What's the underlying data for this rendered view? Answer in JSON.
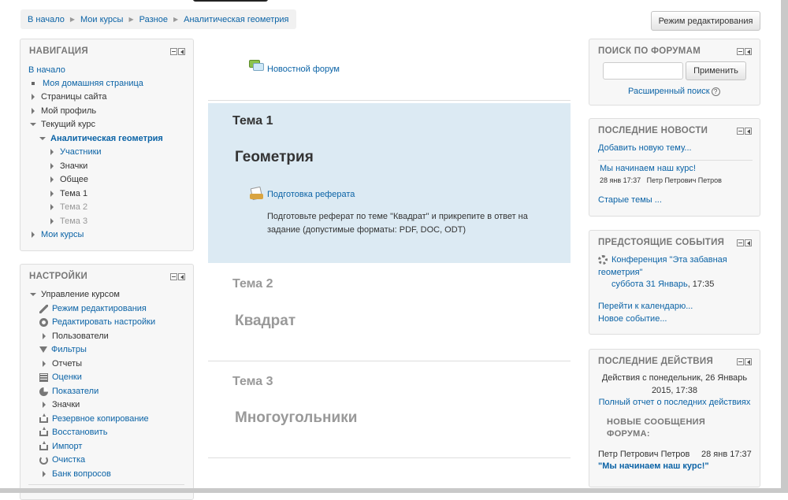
{
  "breadcrumb": [
    "В начало",
    "Мои курсы",
    "Разное",
    "Аналитическая геометрия"
  ],
  "edit_button": "Режим редактирования",
  "navigation": {
    "title": "НАВИГАЦИЯ",
    "home": "В начало",
    "items": [
      "Моя домашняя страница",
      "Страницы сайта",
      "Мой профиль",
      "Текущий курс",
      "Аналитическая геометрия",
      "Участники",
      "Значки",
      "Общее",
      "Тема 1",
      "Тема 2",
      "Тема 3",
      "Мои курсы"
    ]
  },
  "settings": {
    "title": "НАСТРОЙКИ",
    "items": [
      "Управление курсом",
      "Режим редактирования",
      "Редактировать настройки",
      "Пользователи",
      "Фильтры",
      "Отчеты",
      "Оценки",
      "Показатели",
      "Значки",
      "Резервное копирование",
      "Восстановить",
      "Импорт",
      "Очистка",
      "Банк вопросов"
    ]
  },
  "main": {
    "news_forum": "Новостной форум",
    "sections": [
      {
        "title": "Тема 1",
        "summary": "Геометрия",
        "activity": "Подготовка реферата",
        "description": "Подготовьте реферат по теме \"Квадрат\" и прикрепите в ответ на задание (допустимые форматы: PDF, DOC, ODT)"
      },
      {
        "title": "Тема 2",
        "summary": "Квадрат"
      },
      {
        "title": "Тема 3",
        "summary": "Многоугольники"
      }
    ]
  },
  "search_forums": {
    "title": "ПОИСК ПО ФОРУМАМ",
    "button": "Применить",
    "advanced": "Расширенный поиск",
    "help": "?"
  },
  "latest_news": {
    "title": "ПОСЛЕДНИЕ НОВОСТИ",
    "add_topic": "Добавить новую тему...",
    "post_title": "Мы начинаем наш курс!",
    "post_meta": "28 янв 17:37   Петр Петрович Петров",
    "old_topics": "Старые темы ..."
  },
  "upcoming_events": {
    "title": "ПРЕДСТОЯЩИЕ СОБЫТИЯ",
    "event_line1": "Конференция \"Эта забавная",
    "event_line2": "геометрия\"",
    "event_date_link": "суббота 31 Январь",
    "event_time": ", 17:35",
    "goto_calendar": "Перейти к календарю...",
    "new_event": "Новое событие..."
  },
  "recent_activity": {
    "title": "ПОСЛЕДНИЕ ДЕЙСТВИЯ",
    "since_line1": "Действия с понедельник, 26 Январь",
    "since_line2": "2015, 17:38",
    "full_report": "Полный отчет о последних действиях",
    "new_posts_line1": "НОВЫЕ СООБЩЕНИЯ",
    "new_posts_line2": "ФОРУМА:",
    "post_author": "Петр Петрович Петров",
    "post_time": "28 янв 17:37",
    "post_title": "\"Мы начинаем наш курс!\""
  }
}
